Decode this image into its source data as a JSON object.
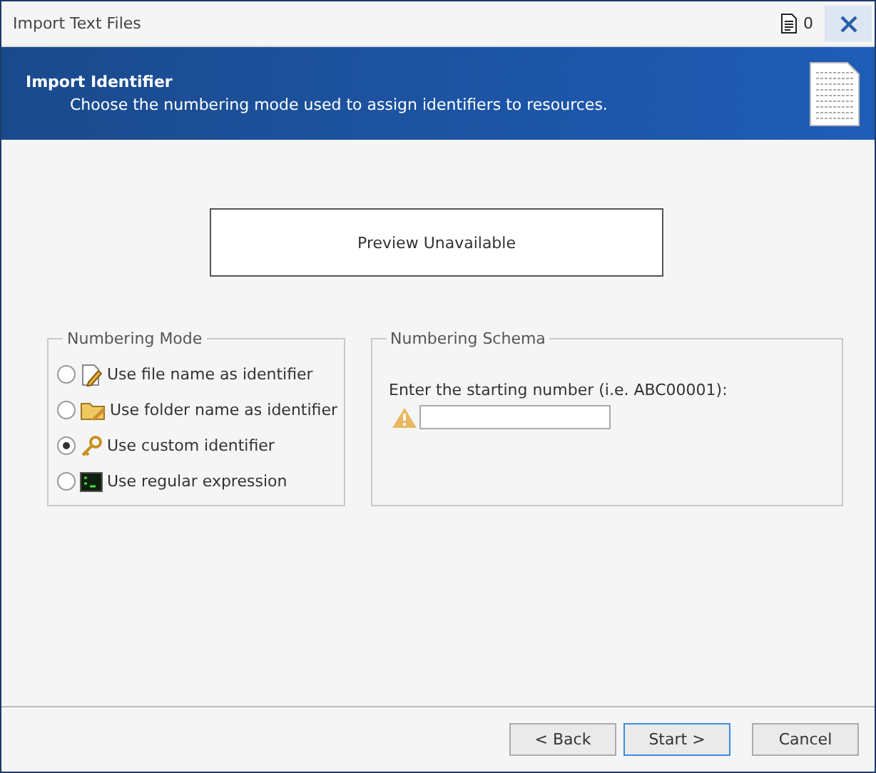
{
  "window": {
    "title": "Import Text Files",
    "document_count": "0"
  },
  "header": {
    "title": "Import Identifier",
    "subtitle": "Choose the numbering mode used to assign identifiers to resources."
  },
  "preview": {
    "text": "Preview Unavailable"
  },
  "numbering_mode": {
    "title": "Numbering Mode",
    "options": [
      {
        "label": "Use file name as identifier",
        "kind": "file",
        "selected": false
      },
      {
        "label": "Use folder name as identifier",
        "kind": "folder",
        "selected": false
      },
      {
        "label": "Use custom identifier",
        "kind": "key",
        "selected": true
      },
      {
        "label": "Use regular expression",
        "kind": "terminal",
        "selected": false
      }
    ]
  },
  "numbering_schema": {
    "title": "Numbering Schema",
    "prompt": "Enter the starting number (i.e. ABC00001):",
    "warning": true
  },
  "buttons": [
    {
      "label": "< Back",
      "focused": false
    },
    {
      "label": "Start >",
      "focused": true
    },
    {
      "label": "Cancel",
      "focused": false
    }
  ]
}
